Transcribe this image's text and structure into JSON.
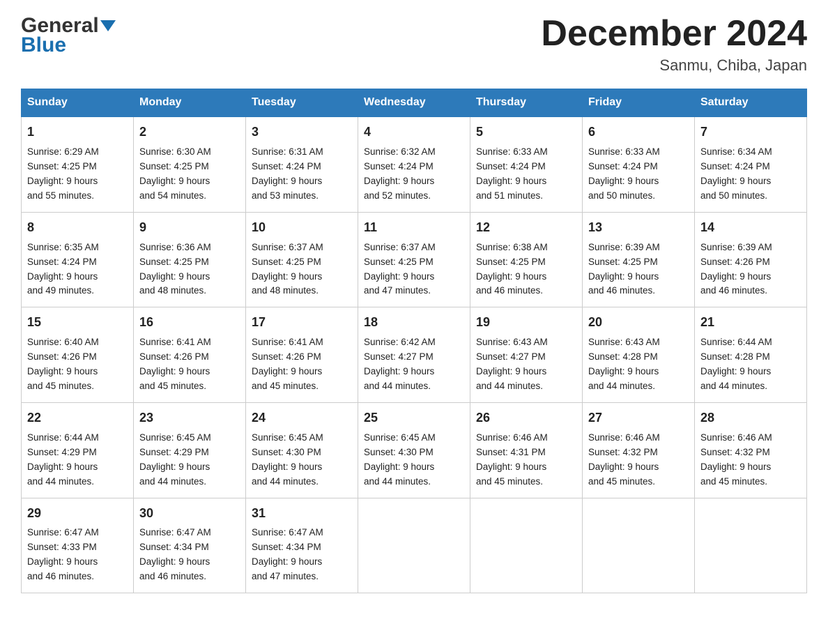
{
  "header": {
    "logo_general": "General",
    "logo_blue": "Blue",
    "title": "December 2024",
    "subtitle": "Sanmu, Chiba, Japan"
  },
  "columns": [
    "Sunday",
    "Monday",
    "Tuesday",
    "Wednesday",
    "Thursday",
    "Friday",
    "Saturday"
  ],
  "weeks": [
    [
      {
        "day": "1",
        "sunrise": "Sunrise: 6:29 AM",
        "sunset": "Sunset: 4:25 PM",
        "daylight": "Daylight: 9 hours",
        "daylight2": "and 55 minutes."
      },
      {
        "day": "2",
        "sunrise": "Sunrise: 6:30 AM",
        "sunset": "Sunset: 4:25 PM",
        "daylight": "Daylight: 9 hours",
        "daylight2": "and 54 minutes."
      },
      {
        "day": "3",
        "sunrise": "Sunrise: 6:31 AM",
        "sunset": "Sunset: 4:24 PM",
        "daylight": "Daylight: 9 hours",
        "daylight2": "and 53 minutes."
      },
      {
        "day": "4",
        "sunrise": "Sunrise: 6:32 AM",
        "sunset": "Sunset: 4:24 PM",
        "daylight": "Daylight: 9 hours",
        "daylight2": "and 52 minutes."
      },
      {
        "day": "5",
        "sunrise": "Sunrise: 6:33 AM",
        "sunset": "Sunset: 4:24 PM",
        "daylight": "Daylight: 9 hours",
        "daylight2": "and 51 minutes."
      },
      {
        "day": "6",
        "sunrise": "Sunrise: 6:33 AM",
        "sunset": "Sunset: 4:24 PM",
        "daylight": "Daylight: 9 hours",
        "daylight2": "and 50 minutes."
      },
      {
        "day": "7",
        "sunrise": "Sunrise: 6:34 AM",
        "sunset": "Sunset: 4:24 PM",
        "daylight": "Daylight: 9 hours",
        "daylight2": "and 50 minutes."
      }
    ],
    [
      {
        "day": "8",
        "sunrise": "Sunrise: 6:35 AM",
        "sunset": "Sunset: 4:24 PM",
        "daylight": "Daylight: 9 hours",
        "daylight2": "and 49 minutes."
      },
      {
        "day": "9",
        "sunrise": "Sunrise: 6:36 AM",
        "sunset": "Sunset: 4:25 PM",
        "daylight": "Daylight: 9 hours",
        "daylight2": "and 48 minutes."
      },
      {
        "day": "10",
        "sunrise": "Sunrise: 6:37 AM",
        "sunset": "Sunset: 4:25 PM",
        "daylight": "Daylight: 9 hours",
        "daylight2": "and 48 minutes."
      },
      {
        "day": "11",
        "sunrise": "Sunrise: 6:37 AM",
        "sunset": "Sunset: 4:25 PM",
        "daylight": "Daylight: 9 hours",
        "daylight2": "and 47 minutes."
      },
      {
        "day": "12",
        "sunrise": "Sunrise: 6:38 AM",
        "sunset": "Sunset: 4:25 PM",
        "daylight": "Daylight: 9 hours",
        "daylight2": "and 46 minutes."
      },
      {
        "day": "13",
        "sunrise": "Sunrise: 6:39 AM",
        "sunset": "Sunset: 4:25 PM",
        "daylight": "Daylight: 9 hours",
        "daylight2": "and 46 minutes."
      },
      {
        "day": "14",
        "sunrise": "Sunrise: 6:39 AM",
        "sunset": "Sunset: 4:26 PM",
        "daylight": "Daylight: 9 hours",
        "daylight2": "and 46 minutes."
      }
    ],
    [
      {
        "day": "15",
        "sunrise": "Sunrise: 6:40 AM",
        "sunset": "Sunset: 4:26 PM",
        "daylight": "Daylight: 9 hours",
        "daylight2": "and 45 minutes."
      },
      {
        "day": "16",
        "sunrise": "Sunrise: 6:41 AM",
        "sunset": "Sunset: 4:26 PM",
        "daylight": "Daylight: 9 hours",
        "daylight2": "and 45 minutes."
      },
      {
        "day": "17",
        "sunrise": "Sunrise: 6:41 AM",
        "sunset": "Sunset: 4:26 PM",
        "daylight": "Daylight: 9 hours",
        "daylight2": "and 45 minutes."
      },
      {
        "day": "18",
        "sunrise": "Sunrise: 6:42 AM",
        "sunset": "Sunset: 4:27 PM",
        "daylight": "Daylight: 9 hours",
        "daylight2": "and 44 minutes."
      },
      {
        "day": "19",
        "sunrise": "Sunrise: 6:43 AM",
        "sunset": "Sunset: 4:27 PM",
        "daylight": "Daylight: 9 hours",
        "daylight2": "and 44 minutes."
      },
      {
        "day": "20",
        "sunrise": "Sunrise: 6:43 AM",
        "sunset": "Sunset: 4:28 PM",
        "daylight": "Daylight: 9 hours",
        "daylight2": "and 44 minutes."
      },
      {
        "day": "21",
        "sunrise": "Sunrise: 6:44 AM",
        "sunset": "Sunset: 4:28 PM",
        "daylight": "Daylight: 9 hours",
        "daylight2": "and 44 minutes."
      }
    ],
    [
      {
        "day": "22",
        "sunrise": "Sunrise: 6:44 AM",
        "sunset": "Sunset: 4:29 PM",
        "daylight": "Daylight: 9 hours",
        "daylight2": "and 44 minutes."
      },
      {
        "day": "23",
        "sunrise": "Sunrise: 6:45 AM",
        "sunset": "Sunset: 4:29 PM",
        "daylight": "Daylight: 9 hours",
        "daylight2": "and 44 minutes."
      },
      {
        "day": "24",
        "sunrise": "Sunrise: 6:45 AM",
        "sunset": "Sunset: 4:30 PM",
        "daylight": "Daylight: 9 hours",
        "daylight2": "and 44 minutes."
      },
      {
        "day": "25",
        "sunrise": "Sunrise: 6:45 AM",
        "sunset": "Sunset: 4:30 PM",
        "daylight": "Daylight: 9 hours",
        "daylight2": "and 44 minutes."
      },
      {
        "day": "26",
        "sunrise": "Sunrise: 6:46 AM",
        "sunset": "Sunset: 4:31 PM",
        "daylight": "Daylight: 9 hours",
        "daylight2": "and 45 minutes."
      },
      {
        "day": "27",
        "sunrise": "Sunrise: 6:46 AM",
        "sunset": "Sunset: 4:32 PM",
        "daylight": "Daylight: 9 hours",
        "daylight2": "and 45 minutes."
      },
      {
        "day": "28",
        "sunrise": "Sunrise: 6:46 AM",
        "sunset": "Sunset: 4:32 PM",
        "daylight": "Daylight: 9 hours",
        "daylight2": "and 45 minutes."
      }
    ],
    [
      {
        "day": "29",
        "sunrise": "Sunrise: 6:47 AM",
        "sunset": "Sunset: 4:33 PM",
        "daylight": "Daylight: 9 hours",
        "daylight2": "and 46 minutes."
      },
      {
        "day": "30",
        "sunrise": "Sunrise: 6:47 AM",
        "sunset": "Sunset: 4:34 PM",
        "daylight": "Daylight: 9 hours",
        "daylight2": "and 46 minutes."
      },
      {
        "day": "31",
        "sunrise": "Sunrise: 6:47 AM",
        "sunset": "Sunset: 4:34 PM",
        "daylight": "Daylight: 9 hours",
        "daylight2": "and 47 minutes."
      },
      {
        "day": "",
        "sunrise": "",
        "sunset": "",
        "daylight": "",
        "daylight2": ""
      },
      {
        "day": "",
        "sunrise": "",
        "sunset": "",
        "daylight": "",
        "daylight2": ""
      },
      {
        "day": "",
        "sunrise": "",
        "sunset": "",
        "daylight": "",
        "daylight2": ""
      },
      {
        "day": "",
        "sunrise": "",
        "sunset": "",
        "daylight": "",
        "daylight2": ""
      }
    ]
  ]
}
